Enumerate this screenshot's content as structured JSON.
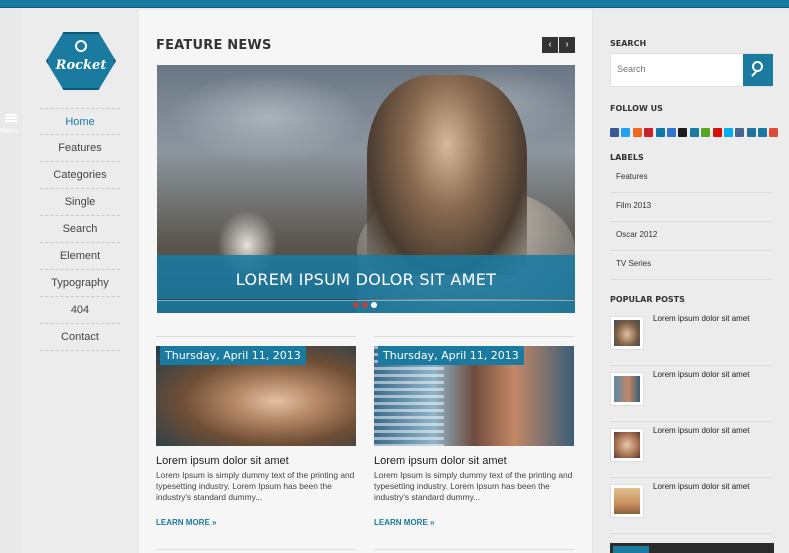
{
  "brand": {
    "name": "Rocket"
  },
  "menu_toggle": {
    "label": "Menu"
  },
  "nav": [
    {
      "label": "Home",
      "active": true
    },
    {
      "label": "Features"
    },
    {
      "label": "Categories"
    },
    {
      "label": "Single"
    },
    {
      "label": "Search"
    },
    {
      "label": "Element"
    },
    {
      "label": "Typography"
    },
    {
      "label": "404"
    },
    {
      "label": "Contact"
    }
  ],
  "feature": {
    "title": "FEATURE NEWS",
    "prev": "‹",
    "next": "›",
    "slide_caption": "LOREM IPSUM DOLOR SIT AMET"
  },
  "posts": [
    {
      "date": "Thursday, April 11, 2013",
      "title": "Lorem ipsum dolor sit amet",
      "excerpt": "Lorem Ipsum is simply dummy text of the printing and typesetting industry. Lorem Ipsum has been the industry's standard dummy...",
      "more": "LEARN MORE »"
    },
    {
      "date": "Thursday, April 11, 2013",
      "title": "Lorem ipsum dolor sit amet",
      "excerpt": "Lorem Ipsum is simply dummy text of the printing and typesetting industry. Lorem Ipsum has been the industry's standard dummy...",
      "more": "LEARN MORE »"
    }
  ],
  "sidebar": {
    "search": {
      "title": "SEARCH",
      "placeholder": "Search"
    },
    "follow": {
      "title": "FOLLOW US",
      "icons": [
        "facebook-icon",
        "twitter-icon",
        "rss-icon",
        "pinterest-icon",
        "linkedin-icon",
        "delicious-icon",
        "digg-icon",
        "stumbleupon-icon",
        "evernote-icon",
        "lastfm-icon",
        "skype-icon",
        "vk-icon",
        "wordpress-icon",
        "email-icon",
        "google-icon"
      ],
      "colors": [
        "#3b5998",
        "#1da1f2",
        "#f26522",
        "#cb2027",
        "#0e76a8",
        "#3274d1",
        "#1d1d1d",
        "#1a7aa0",
        "#5ba525",
        "#d51007",
        "#00aff0",
        "#45668e",
        "#21759b",
        "#1a7aa0",
        "#dd4b39"
      ]
    },
    "labels": {
      "title": "LABELS",
      "items": [
        "Features",
        "Film 2013",
        "Oscar 2012",
        "TV Series"
      ]
    },
    "popular": {
      "title": "POPULAR POSTS",
      "items": [
        "Lorem ipsum dolor sit amet",
        "Lorem ipsum dolor sit amet",
        "Lorem ipsum dolor sit amet",
        "Lorem ipsum dolor sit amet"
      ]
    }
  },
  "colors": {
    "accent": "#1a7aa0",
    "background": "#e9e9e9"
  }
}
